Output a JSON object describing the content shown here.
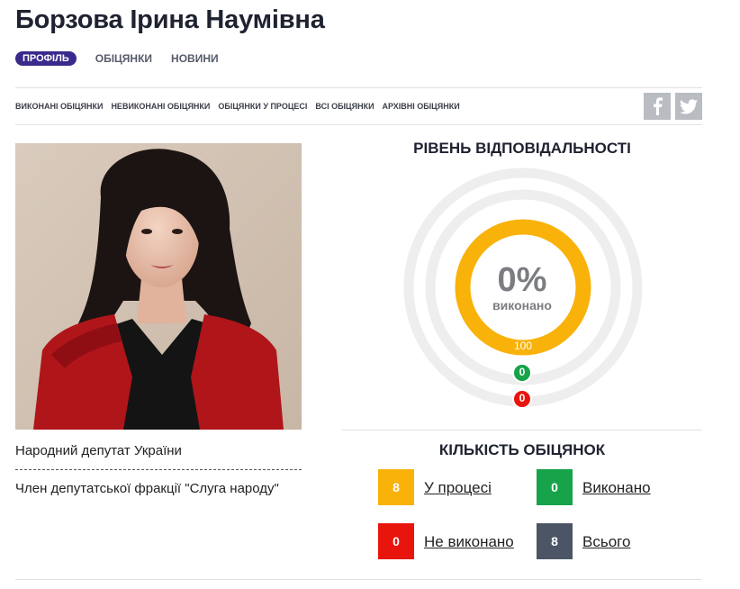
{
  "header": {
    "title": "Борзова Ірина Наумівна"
  },
  "main_tabs": [
    {
      "label": "ПРОФІЛЬ",
      "active": true
    },
    {
      "label": "ОБІЦЯНКИ",
      "active": false
    },
    {
      "label": "НОВИНИ",
      "active": false
    }
  ],
  "sub_tabs": [
    {
      "label": "ВИКОНАНІ ОБІЦЯНКИ"
    },
    {
      "label": "НЕВИКОНАНІ ОБІЦЯНКИ"
    },
    {
      "label": "ОБІЦЯНКИ У ПРОЦЕСІ"
    },
    {
      "label": "ВСІ ОБІЦЯНКИ"
    },
    {
      "label": "АРХІВНІ ОБІЦЯНКИ"
    }
  ],
  "social": {
    "facebook_icon": "facebook-icon",
    "twitter_icon": "twitter-icon"
  },
  "profile": {
    "position": "Народний депутат України",
    "faction": "Член депутатської фракції \"Слуга народу\""
  },
  "responsibility": {
    "title": "РІВЕНЬ ВІДПОВІДАЛЬНОСТІ",
    "percent": "0%",
    "caption": "виконано",
    "in_progress_count": "100",
    "done_count": "0",
    "failed_count": "0"
  },
  "promises": {
    "title": "КІЛЬКІСТЬ ОБІЦЯНОК",
    "in_progress": {
      "value": "8",
      "label": "У процесі"
    },
    "done": {
      "value": "0",
      "label": "Виконано"
    },
    "failed": {
      "value": "0",
      "label": "Не виконано"
    },
    "total": {
      "value": "8",
      "label": "Всього"
    }
  },
  "colors": {
    "accent": "#3a2a8c",
    "in_progress": "#f9b20a",
    "done": "#16a34a",
    "failed": "#e8150d",
    "total": "#4b5565",
    "ring_bg": "#eeeeee"
  }
}
